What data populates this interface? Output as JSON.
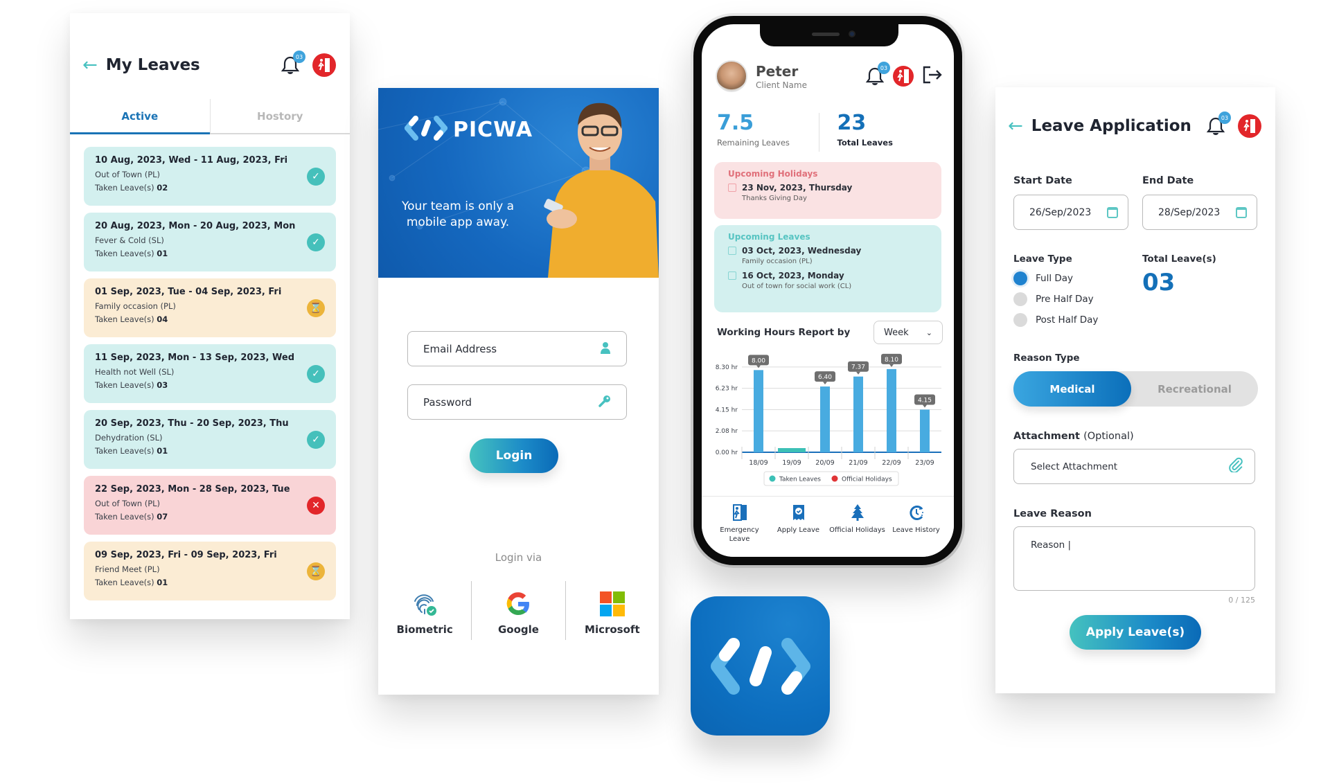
{
  "my_leaves": {
    "title": "My Leaves",
    "notification_count": "03",
    "tabs": [
      {
        "label": "Active",
        "active": true
      },
      {
        "label": "Hostory",
        "active": false
      }
    ],
    "taken_label": "Taken Leave(s)",
    "items": [
      {
        "dates": "10 Aug, 2023, Wed - 11 Aug, 2023, Fri",
        "reason": "Out of Town (PL)",
        "taken": "02",
        "status": "approved",
        "status_icon": "check-icon"
      },
      {
        "dates": "20 Aug, 2023, Mon - 20 Aug, 2023, Mon",
        "reason": "Fever & Cold (SL)",
        "taken": "01",
        "status": "approved",
        "status_icon": "check-icon"
      },
      {
        "dates": "01 Sep, 2023, Tue - 04 Sep, 2023, Fri",
        "reason": "Family occasion (PL)",
        "taken": "04",
        "status": "pending",
        "status_icon": "hourglass-icon"
      },
      {
        "dates": "11 Sep, 2023, Mon - 13 Sep, 2023, Wed",
        "reason": "Health not Well (SL)",
        "taken": "03",
        "status": "approved",
        "status_icon": "check-icon"
      },
      {
        "dates": "20 Sep, 2023, Thu - 20 Sep, 2023, Thu",
        "reason": "Dehydration (SL)",
        "taken": "01",
        "status": "approved",
        "status_icon": "check-icon"
      },
      {
        "dates": "22 Sep, 2023, Mon - 28 Sep, 2023, Tue",
        "reason": "Out of Town (PL)",
        "taken": "07",
        "status": "rejected",
        "status_icon": "close-icon"
      },
      {
        "dates": "09 Sep, 2023, Fri - 09 Sep, 2023, Fri",
        "reason": "Friend Meet (PL)",
        "taken": "01",
        "status": "pending",
        "status_icon": "hourglass-icon"
      }
    ]
  },
  "login": {
    "brand_name": "PICWA",
    "tagline": "Your team is only a mobile app away.",
    "email_placeholder": "Email Address",
    "password_placeholder": "Password",
    "login_button": "Login",
    "login_via": "Login via",
    "providers": [
      {
        "label": "Biometric",
        "icon": "fingerprint-icon"
      },
      {
        "label": "Google",
        "icon": "google-icon"
      },
      {
        "label": "Microsoft",
        "icon": "microsoft-icon"
      }
    ]
  },
  "dashboard": {
    "user_name": "Peter",
    "user_subtitle": "Client Name",
    "notification_count": "03",
    "stats": {
      "remaining_value": "7.5",
      "remaining_label": "Remaining Leaves",
      "total_value": "23",
      "total_label": "Total Leaves"
    },
    "upcoming_holidays": {
      "title": "Upcoming Holidays",
      "items": [
        {
          "date": "23 Nov, 2023, Thursday",
          "desc": "Thanks Giving Day"
        }
      ]
    },
    "upcoming_leaves": {
      "title": "Upcoming Leaves",
      "items": [
        {
          "date": "03 Oct, 2023, Wednesday",
          "desc": "Family occasion (PL)"
        },
        {
          "date": "16 Oct, 2023, Monday",
          "desc": "Out of town for social work (CL)"
        }
      ]
    },
    "report_title": "Working Hours Report by",
    "period_select": "Week",
    "tabbar": [
      {
        "label": "Emergency Leave",
        "icon": "emergency-exit-icon"
      },
      {
        "label": "Apply Leave",
        "icon": "apply-leave-icon"
      },
      {
        "label": "Official Holidays",
        "icon": "tree-icon"
      },
      {
        "label": "Leave History",
        "icon": "history-icon"
      }
    ]
  },
  "chart_data": {
    "type": "bar",
    "title": "Working Hours Report by",
    "categories": [
      "18/09",
      "19/09",
      "20/09",
      "21/09",
      "22/09",
      "23/09"
    ],
    "values": [
      8.0,
      0,
      6.4,
      7.37,
      8.1,
      4.15
    ],
    "value_labels": [
      "8.00",
      "",
      "6.40",
      "7.37",
      "8.10",
      "4.15"
    ],
    "taken_leave_days": [
      "19/09"
    ],
    "yticks": [
      0,
      2.08,
      4.15,
      6.23,
      8.3
    ],
    "ytick_labels": [
      "0.00 hr",
      "2.08 hr",
      "4.15 hr",
      "6.23 hr",
      "8.30 hr"
    ],
    "ylim": [
      0,
      8.9
    ],
    "grid": true,
    "legend": [
      {
        "label": "Taken Leaves",
        "color": "#3cc0b6"
      },
      {
        "label": "Official Holidays",
        "color": "#e03436"
      }
    ],
    "legend_position": "bottom",
    "colors": {
      "bar": "#48abe0",
      "leave": "#3cc0b6",
      "tooltip": "#6e6e6e"
    }
  },
  "leave_application": {
    "title": "Leave Application",
    "notification_count": "03",
    "start_date_label": "Start Date",
    "start_date": "26/Sep/2023",
    "end_date_label": "End Date",
    "end_date": "28/Sep/2023",
    "leave_type_label": "Leave Type",
    "leave_types": [
      {
        "label": "Full Day",
        "selected": true
      },
      {
        "label": "Pre Half Day",
        "selected": false
      },
      {
        "label": "Post Half Day",
        "selected": false
      }
    ],
    "total_label": "Total Leave(s)",
    "total_value": "03",
    "reason_type_label": "Reason Type",
    "reason_types": [
      {
        "label": "Medical",
        "selected": true
      },
      {
        "label": "Recreational",
        "selected": false
      }
    ],
    "attachment_label": "Attachment",
    "attachment_optional": "(Optional)",
    "attachment_placeholder": "Select Attachment",
    "leave_reason_label": "Leave Reason",
    "reason_value": "Reason  |",
    "char_counter": "0 / 125",
    "apply_button": "Apply Leave(s)"
  },
  "colors": {
    "primary": "#1470b8",
    "accent_teal": "#47c1c0",
    "danger": "#e2262a",
    "pending": "#ecb43a"
  }
}
